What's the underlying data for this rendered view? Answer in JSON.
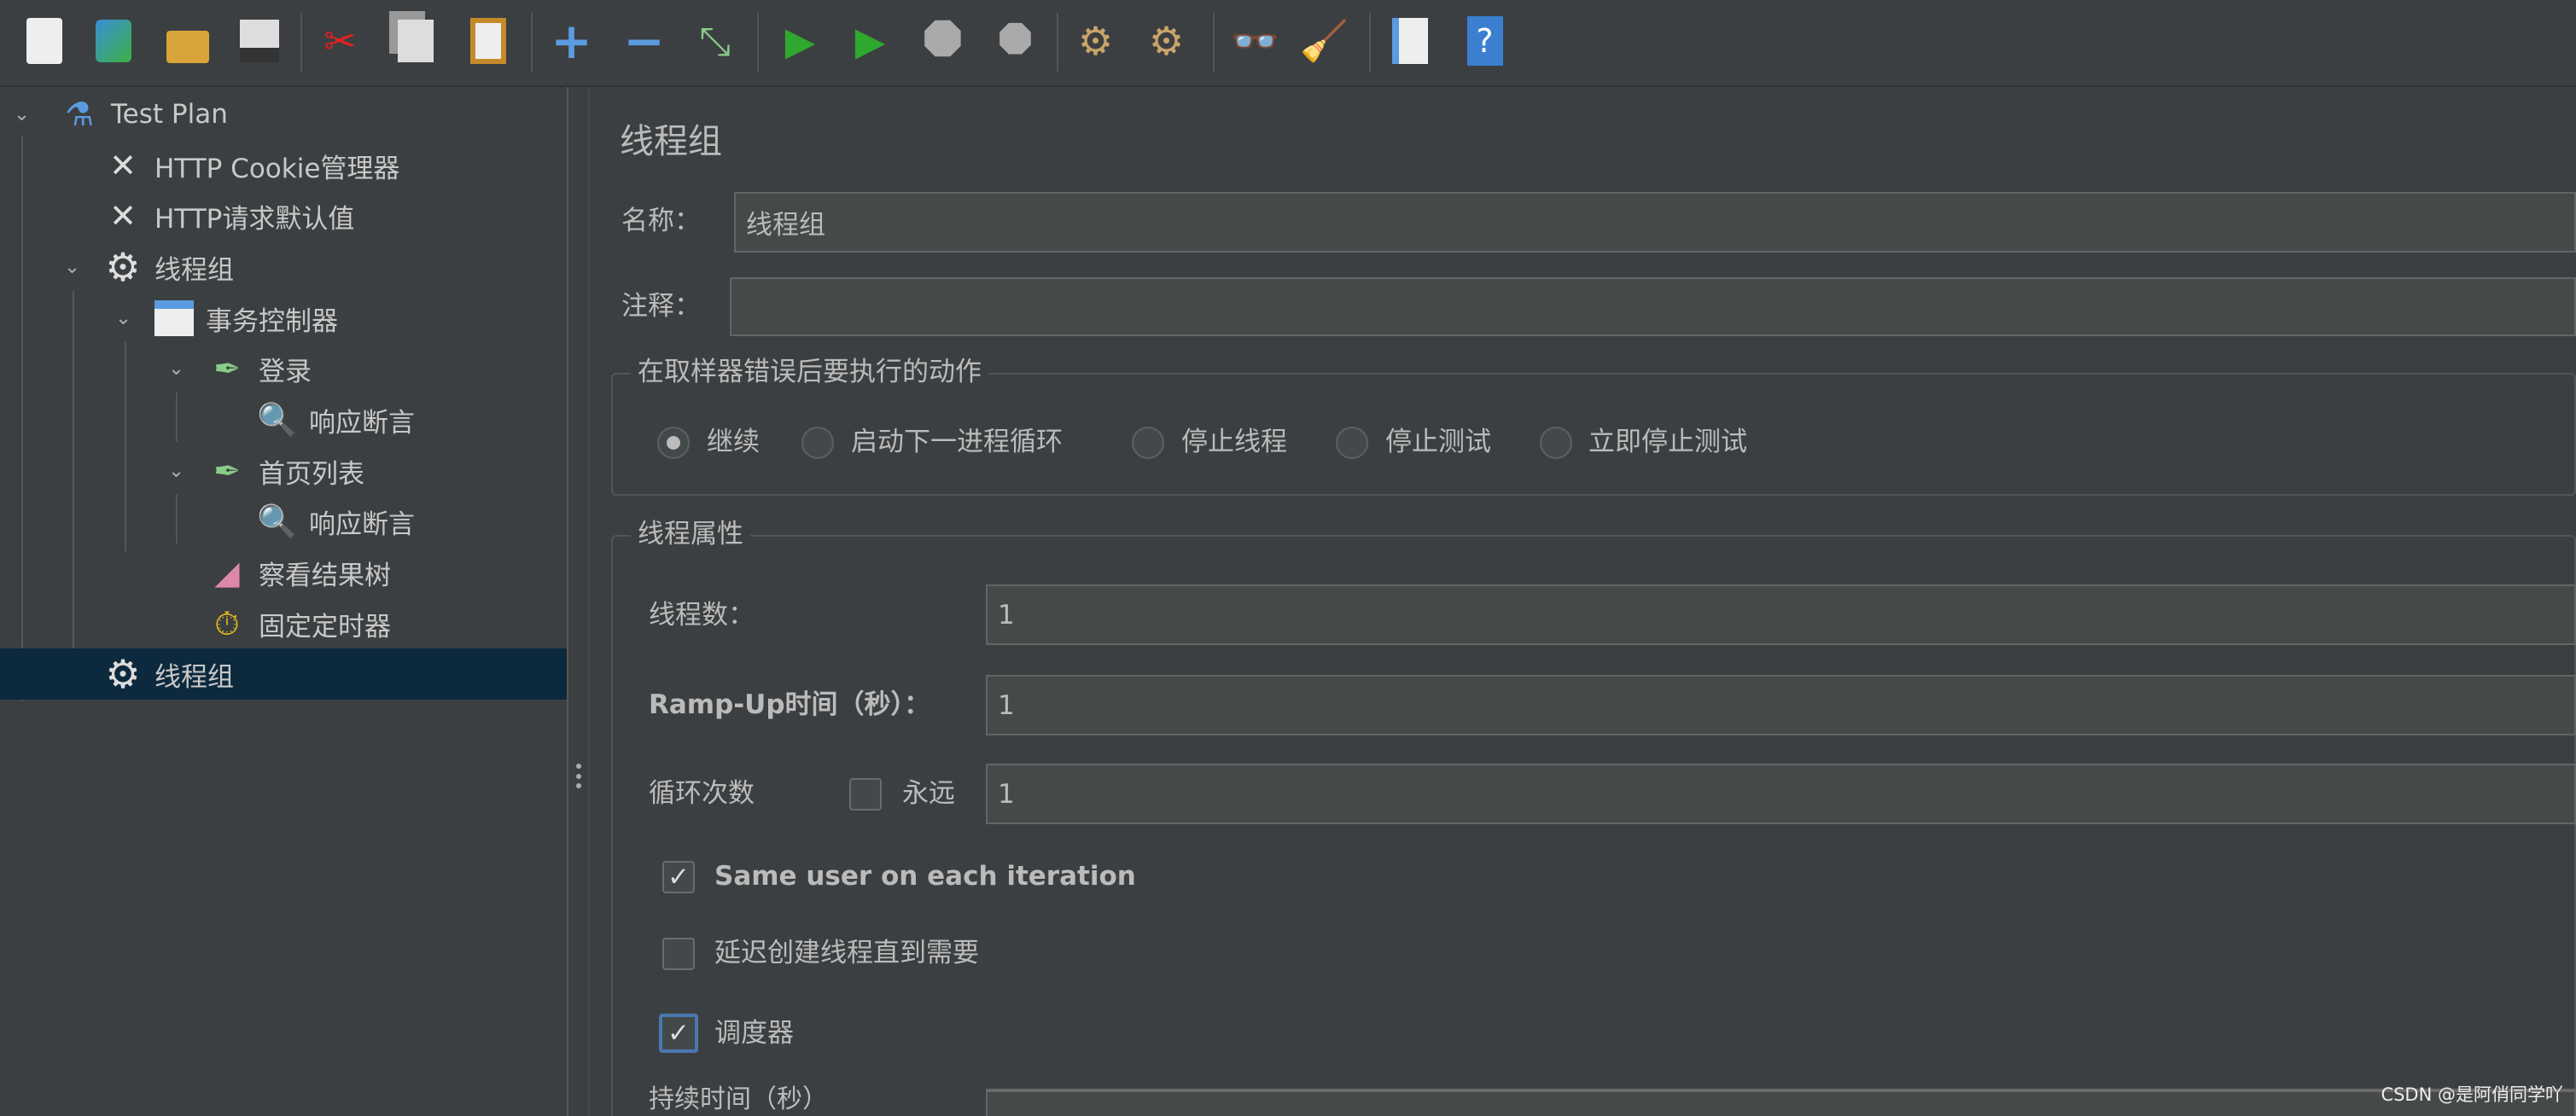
{
  "toolbar": {
    "icons": [
      "new-icon",
      "templates-icon",
      "open-icon",
      "save-icon",
      "cut-icon",
      "copy-icon",
      "paste-icon",
      "expand-icon",
      "collapse-icon",
      "toggle-icon",
      "start-icon",
      "start-no-pauses-icon",
      "stop-icon",
      "shutdown-icon",
      "clear-icon",
      "clear-all-icon",
      "search-icon",
      "reset-search-icon",
      "function-helper-icon",
      "help-icon"
    ]
  },
  "tree": {
    "items": [
      {
        "label": "Test Plan",
        "icon": "test-plan-icon"
      },
      {
        "label": "HTTP Cookie管理器",
        "icon": "wrench-icon"
      },
      {
        "label": "HTTP请求默认值",
        "icon": "wrench-icon"
      },
      {
        "label": "线程组",
        "icon": "gear-icon"
      },
      {
        "label": "事务控制器",
        "icon": "controller-icon"
      },
      {
        "label": "登录",
        "icon": "sampler-pipette-icon"
      },
      {
        "label": "响应断言",
        "icon": "assertion-magnifier-icon"
      },
      {
        "label": "首页列表",
        "icon": "sampler-pipette-icon"
      },
      {
        "label": "响应断言",
        "icon": "assertion-magnifier-icon"
      },
      {
        "label": "察看结果树",
        "icon": "listener-chart-icon"
      },
      {
        "label": "固定定时器",
        "icon": "timer-clock-icon"
      },
      {
        "label": "线程组",
        "icon": "gear-icon",
        "selected": true
      }
    ]
  },
  "panel": {
    "title": "线程组",
    "name_label": "名称：",
    "name_value": "线程组",
    "comment_label": "注释：",
    "comment_value": "",
    "error_action": {
      "title": "在取样器错误后要执行的动作",
      "options": [
        "继续",
        "启动下一进程循环",
        "停止线程",
        "停止测试",
        "立即停止测试"
      ],
      "selected": "继续"
    },
    "thread_props": {
      "title": "线程属性",
      "threads_label": "线程数：",
      "threads_value": "1",
      "rampup_label": "Ramp-Up时间（秒）：",
      "rampup_value": "1",
      "loop_label": "循环次数",
      "forever_label": "永远",
      "forever_checked": false,
      "loop_value": "1",
      "same_user_label": "Same user on each iteration",
      "same_user_checked": true,
      "delay_label": "延迟创建线程直到需要",
      "delay_checked": false,
      "scheduler_label": "调度器",
      "scheduler_checked": true,
      "duration_label": "持续时间（秒）",
      "duration_value": ""
    }
  },
  "watermark": "CSDN @是阿俏同学吖",
  "colors": {
    "background": "#3c3f41",
    "input": "#45494a",
    "selected_row": "#0d293e",
    "text": "#bbbbbb",
    "focus": "#4a78b0"
  }
}
